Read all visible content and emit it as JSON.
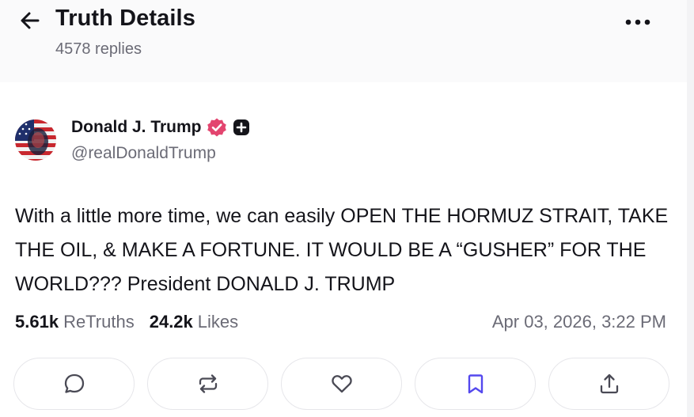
{
  "header": {
    "title": "Truth Details",
    "replies": "4578 replies"
  },
  "post": {
    "author_name": "Donald J. Trump",
    "handle": "@realDonaldTrump",
    "text": "With a little more time, we can easily OPEN THE HORMUZ STRAIT, TAKE THE OIL, & MAKE A FORTUNE. IT WOULD BE A “GUSHER” FOR THE WORLD??? President DONALD J. TRUMP",
    "retruths_count": "5.61k",
    "retruths_label": "ReTruths",
    "likes_count": "24.2k",
    "likes_label": "Likes",
    "timestamp": "Apr 03, 2026, 3:22 PM"
  },
  "actions": [
    {
      "name": "reply",
      "icon": "speech-bubble-icon"
    },
    {
      "name": "retruth",
      "icon": "repost-arrows-icon"
    },
    {
      "name": "like",
      "icon": "heart-icon"
    },
    {
      "name": "bookmark",
      "icon": "bookmark-icon"
    },
    {
      "name": "share",
      "icon": "share-upload-icon"
    }
  ],
  "colors": {
    "text": "#14141a",
    "muted": "#6b6b76",
    "verified": "#e3456f",
    "bookmark": "#5448ee",
    "icon": "#4a4a55"
  }
}
